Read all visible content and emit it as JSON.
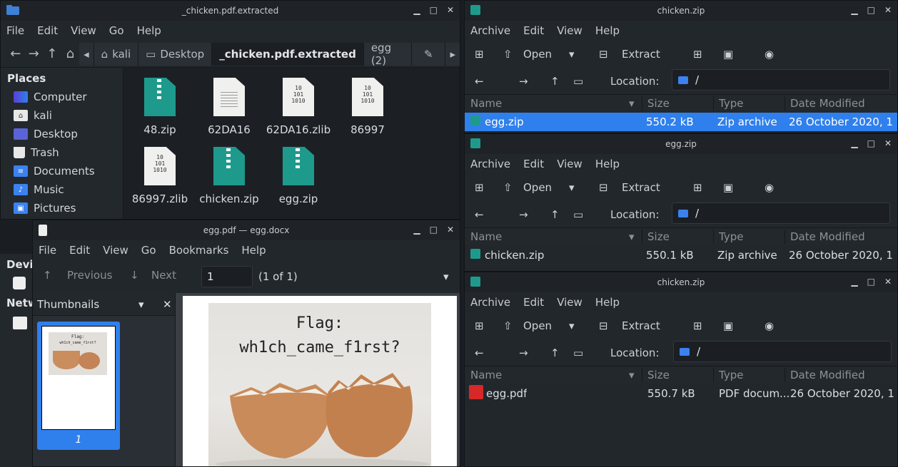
{
  "file_manager": {
    "title": "_chicken.pdf.extracted",
    "menu": [
      "File",
      "Edit",
      "View",
      "Go",
      "Help"
    ],
    "breadcrumbs": [
      "kali",
      "Desktop",
      "_chicken.pdf.extracted",
      "egg (2)"
    ],
    "places_heading": "Places",
    "places": [
      "Computer",
      "kali",
      "Desktop",
      "Trash",
      "Documents",
      "Music",
      "Pictures"
    ],
    "devices_heading": "Devi",
    "network_heading": "Netw",
    "files": [
      "48.zip",
      "62DA16",
      "62DA16.zlib",
      "86997",
      "86997.zlib",
      "chicken.zip",
      "egg.zip"
    ]
  },
  "archive1": {
    "title": "chicken.zip",
    "menu": [
      "Archive",
      "Edit",
      "View",
      "Help"
    ],
    "open_label": "Open",
    "extract_label": "Extract",
    "location_label": "Location:",
    "location_value": "/",
    "columns": [
      "Name",
      "Size",
      "Type",
      "Date Modified"
    ],
    "row": {
      "name": "egg.zip",
      "size": "550.2 kB",
      "type": "Zip archive",
      "date": "26 October 2020, 1..."
    }
  },
  "archive2": {
    "title": "egg.zip",
    "menu": [
      "Archive",
      "Edit",
      "View",
      "Help"
    ],
    "open_label": "Open",
    "extract_label": "Extract",
    "location_label": "Location:",
    "location_value": "/",
    "columns": [
      "Name",
      "Size",
      "Type",
      "Date Modified"
    ],
    "row": {
      "name": "chicken.zip",
      "size": "550.1 kB",
      "type": "Zip archive",
      "date": "26 October 2020, 1..."
    }
  },
  "archive3": {
    "title": "chicken.zip",
    "menu": [
      "Archive",
      "Edit",
      "View",
      "Help"
    ],
    "open_label": "Open",
    "extract_label": "Extract",
    "location_label": "Location:",
    "location_value": "/",
    "columns": [
      "Name",
      "Size",
      "Type",
      "Date Modified"
    ],
    "row": {
      "name": "egg.pdf",
      "size": "550.7 kB",
      "type": "PDF docum...",
      "date": "26 October 2020, 1..."
    }
  },
  "pdf_viewer": {
    "title": "egg.pdf — egg.docx",
    "menu": [
      "File",
      "Edit",
      "View",
      "Go",
      "Bookmarks",
      "Help"
    ],
    "previous_label": "Previous",
    "next_label": "Next",
    "page_value": "1",
    "page_count": "(1 of 1)",
    "thumbnails_label": "Thumbnails",
    "thumb_page_number": "1",
    "flag_line1": "Flag:",
    "flag_line2": "wh1ch_came_f1rst?"
  },
  "colors": {
    "accent": "#2f80ed",
    "zip_teal": "#1e9a8d",
    "pdf_red": "#d62828"
  }
}
